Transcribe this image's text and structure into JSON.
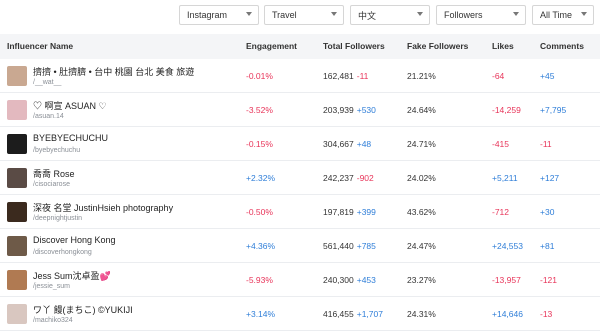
{
  "filters": {
    "platform": "Instagram",
    "category": "Travel",
    "language": "中文",
    "metric": "Followers",
    "period": "All Time"
  },
  "table": {
    "headers": {
      "influencer": "Influencer Name",
      "engagement": "Engagement",
      "total_followers": "Total Followers",
      "fake_followers": "Fake Followers",
      "likes": "Likes",
      "comments": "Comments"
    },
    "rows": [
      {
        "name": "擠擠 • 肚擠臍 • 台中 桃園 台北 美食 旅遊",
        "handle": "/__wat__",
        "engagement": "-0.01%",
        "eng_sign": "neg",
        "followers": "162,481",
        "followers_delta": "-11",
        "fd_sign": "neg",
        "fake": "21.21%",
        "likes": "-64",
        "likes_sign": "neg",
        "comments": "+45",
        "comments_sign": "pos",
        "avatar_color": "#c9a891"
      },
      {
        "name": "♡ 啊宣 ASUAN ♡",
        "handle": "/asuan.14",
        "engagement": "-3.52%",
        "eng_sign": "neg",
        "followers": "203,939",
        "followers_delta": "+530",
        "fd_sign": "pos",
        "fake": "24.64%",
        "likes": "-14,259",
        "likes_sign": "neg",
        "comments": "+7,795",
        "comments_sign": "pos",
        "avatar_color": "#e3b9bf"
      },
      {
        "name": "BYEBYECHUCHU",
        "handle": "/byebyechuchu",
        "engagement": "-0.15%",
        "eng_sign": "neg",
        "followers": "304,667",
        "followers_delta": "+48",
        "fd_sign": "pos",
        "fake": "24.71%",
        "likes": "-415",
        "likes_sign": "neg",
        "comments": "-11",
        "comments_sign": "neg",
        "avatar_color": "#1c1c1c"
      },
      {
        "name": "喬喬 Rose",
        "handle": "/cisociarose",
        "engagement": "+2.32%",
        "eng_sign": "pos",
        "followers": "242,237",
        "followers_delta": "-902",
        "fd_sign": "neg",
        "fake": "24.02%",
        "likes": "+5,211",
        "likes_sign": "pos",
        "comments": "+127",
        "comments_sign": "pos",
        "avatar_color": "#5a4b45"
      },
      {
        "name": "深夜 名堂 JustinHsieh photography",
        "handle": "/deepnightjustin",
        "engagement": "-0.50%",
        "eng_sign": "neg",
        "followers": "197,819",
        "followers_delta": "+399",
        "fd_sign": "pos",
        "fake": "43.62%",
        "likes": "-712",
        "likes_sign": "neg",
        "comments": "+30",
        "comments_sign": "pos",
        "avatar_color": "#3b2a1e"
      },
      {
        "name": "Discover Hong Kong",
        "handle": "/discoverhongkong",
        "engagement": "+4.36%",
        "eng_sign": "pos",
        "followers": "561,440",
        "followers_delta": "+785",
        "fd_sign": "pos",
        "fake": "24.47%",
        "likes": "+24,553",
        "likes_sign": "pos",
        "comments": "+81",
        "comments_sign": "pos",
        "avatar_color": "#6e5a48"
      },
      {
        "name": "Jess Sum沈卓盈💕",
        "handle": "/jessie_sum",
        "engagement": "-5.93%",
        "eng_sign": "neg",
        "followers": "240,300",
        "followers_delta": "+453",
        "fd_sign": "pos",
        "fake": "23.27%",
        "likes": "-13,957",
        "likes_sign": "neg",
        "comments": "-121",
        "comments_sign": "neg",
        "avatar_color": "#b07a52"
      },
      {
        "name": "ワ丫 饅(まちこ) ©YUKIJI",
        "handle": "/machiko324",
        "engagement": "+3.14%",
        "eng_sign": "pos",
        "followers": "416,455",
        "followers_delta": "+1,707",
        "fd_sign": "pos",
        "fake": "24.31%",
        "likes": "+14,646",
        "likes_sign": "pos",
        "comments": "-13",
        "comments_sign": "neg",
        "avatar_color": "#d9c7c0"
      }
    ]
  }
}
